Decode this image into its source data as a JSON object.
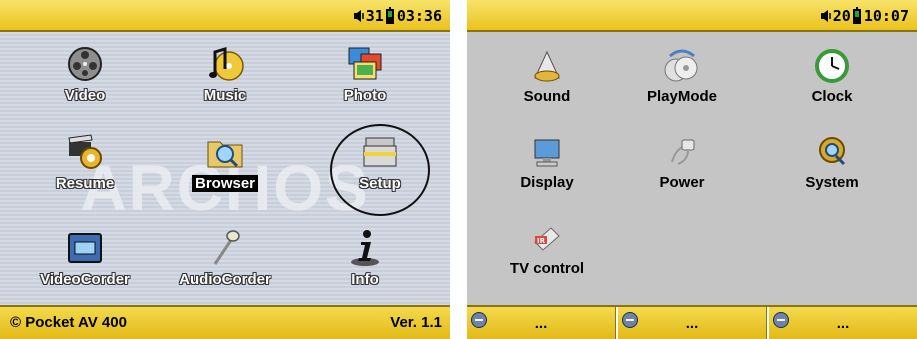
{
  "left_screen": {
    "status": {
      "volume": "31",
      "time": "03:36"
    },
    "watermark": "ARCHOS",
    "menu": [
      {
        "label": "Video",
        "icon": "film-reel-icon"
      },
      {
        "label": "Music",
        "icon": "music-note-cd-icon"
      },
      {
        "label": "Photo",
        "icon": "photo-frames-icon"
      },
      {
        "label": "Resume",
        "icon": "clapper-gear-icon"
      },
      {
        "label": "Browser",
        "icon": "folder-magnifier-icon"
      },
      {
        "label": "Setup",
        "icon": "toolbox-icon"
      },
      {
        "label": "VideoCorder",
        "icon": "video-cassette-icon"
      },
      {
        "label": "AudioCorder",
        "icon": "microphone-icon"
      },
      {
        "label": "Info",
        "icon": "info-icon"
      }
    ],
    "selected": "Browser",
    "footer": {
      "product": "© Pocket AV 400",
      "version": "Ver. 1.1"
    }
  },
  "right_screen": {
    "status": {
      "volume": "20",
      "time": "10:07"
    },
    "menu": [
      {
        "label": "Sound",
        "icon": "speaker-icon"
      },
      {
        "label": "PlayMode",
        "icon": "discs-icon"
      },
      {
        "label": "Clock",
        "icon": "clock-icon"
      },
      {
        "label": "Display",
        "icon": "monitor-icon"
      },
      {
        "label": "Power",
        "icon": "power-plug-icon"
      },
      {
        "label": "System",
        "icon": "gear-magnifier-icon"
      },
      {
        "label": "TV control",
        "icon": "ir-remote-icon"
      }
    ],
    "softkeys": [
      "...",
      "...",
      "..."
    ]
  },
  "colors": {
    "bar": "#e9c21d",
    "left_bg": "#d5d9e4",
    "right_bg": "#c5c5c5",
    "icon_blue": "#6d83a8"
  }
}
